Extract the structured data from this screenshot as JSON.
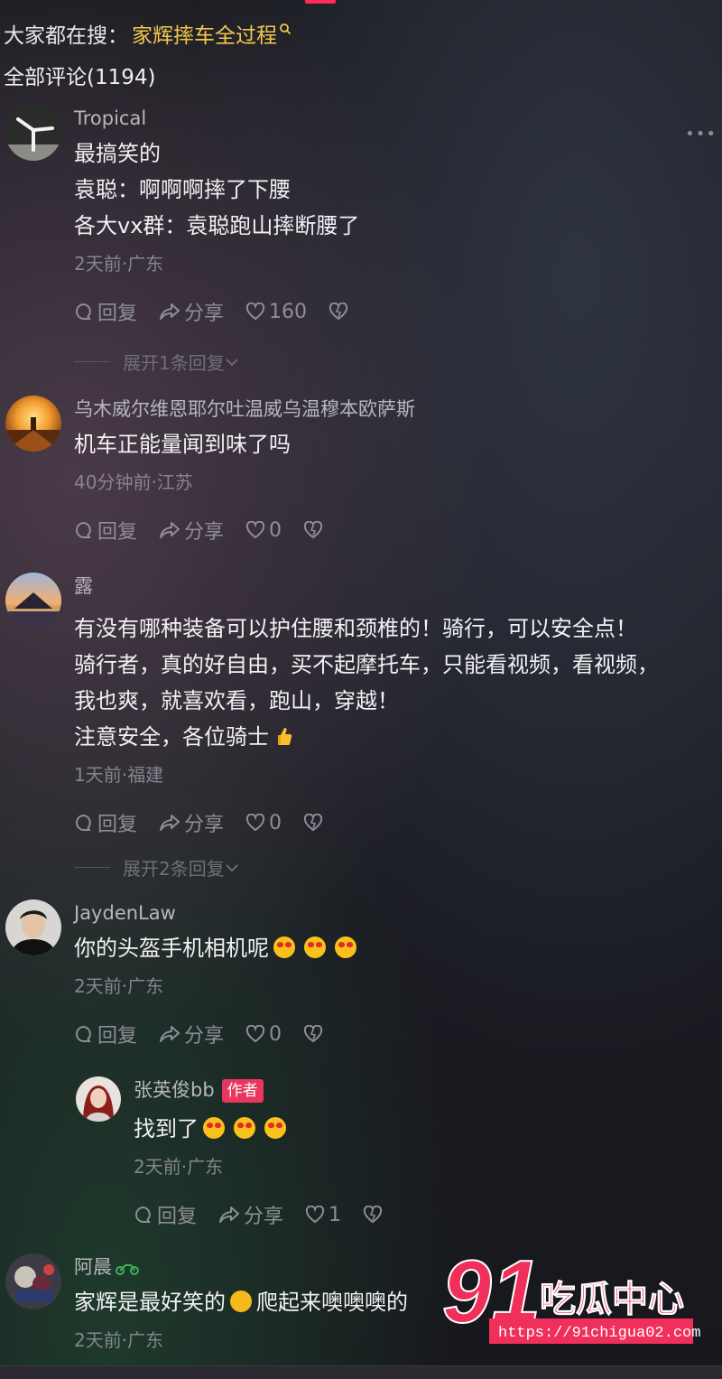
{
  "search": {
    "prefix": "大家都在搜：",
    "term": "家辉摔车全过程"
  },
  "comments_total": "全部评论(1194)",
  "actions": {
    "reply": "回复",
    "share": "分享"
  },
  "comments": [
    {
      "name": "Tropical",
      "lines": [
        "最搞笑的",
        "袁聪：啊啊啊摔了下腰",
        "各大vx群：袁聪跑山摔断腰了"
      ],
      "meta": "2天前·广东",
      "likes": "160",
      "expand": "展开1条回复"
    },
    {
      "name": "乌木威尔维恩耶尔吐温威乌温穆本欧萨斯",
      "lines": [
        "机车正能量闻到味了吗"
      ],
      "meta": "40分钟前·江苏",
      "likes": "0"
    },
    {
      "name": "露",
      "lines": [
        "有没有哪种装备可以护住腰和颈椎的！骑行，可以安全点！",
        "骑行者，真的好自由，买不起摩托车，只能看视频，看视频，",
        "我也爽，就喜欢看，跑山，穿越！",
        "注意安全，各位骑士"
      ],
      "meta": "1天前·福建",
      "likes": "0",
      "expand": "展开2条回复"
    },
    {
      "name": "JaydenLaw",
      "lines": [
        "你的头盔手机相机呢"
      ],
      "meta": "2天前·广东",
      "likes": "0"
    },
    {
      "name": "张英俊bb",
      "badge": "作者",
      "lines": [
        "找到了"
      ],
      "meta": "2天前·广东",
      "likes": "1"
    },
    {
      "name": "阿晨",
      "lines": [
        "家辉是最好笑的",
        "爬起来噢噢噢的"
      ],
      "meta": "2天前·广东"
    }
  ],
  "watermark": {
    "number": "91",
    "name": "吃瓜中心",
    "url": "https://91chigua02.com"
  },
  "colors": {
    "accent": "#fe2c55",
    "search_term": "#f2c94c",
    "author_badge": "#e8365e"
  }
}
